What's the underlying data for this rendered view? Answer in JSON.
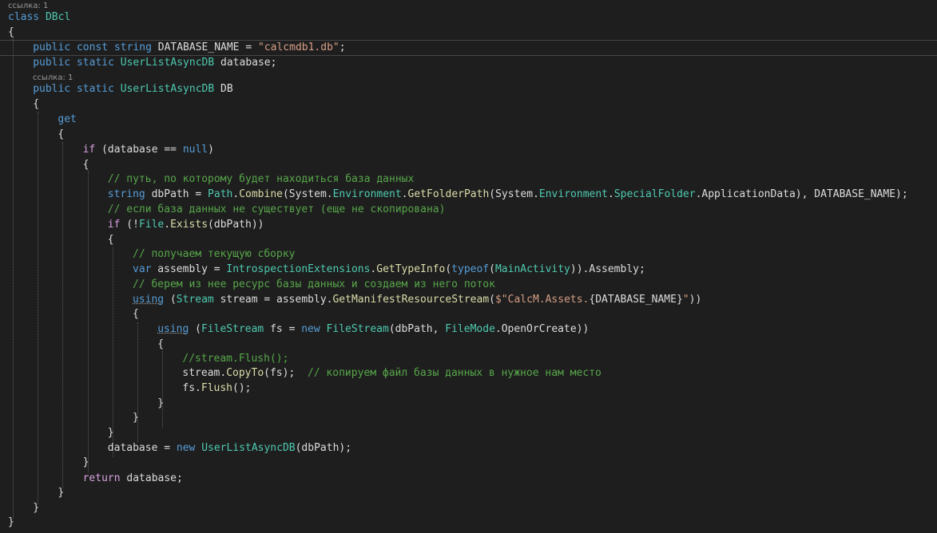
{
  "editor": {
    "code_lens": [
      {
        "text": "ссылка: 1"
      },
      {
        "text": "ссылка: 1"
      }
    ],
    "lines": [
      {
        "tokens": [
          {
            "t": "class",
            "k": "kw"
          },
          {
            "t": " "
          },
          {
            "t": "DBcl",
            "k": "type"
          }
        ]
      },
      {
        "tokens": [
          {
            "t": "{"
          }
        ]
      },
      {
        "tokens": [
          {
            "t": "public",
            "k": "kw"
          },
          {
            "t": " "
          },
          {
            "t": "const",
            "k": "kw"
          },
          {
            "t": " "
          },
          {
            "t": "string",
            "k": "kw"
          },
          {
            "t": " DATABASE_NAME = "
          },
          {
            "t": "\"calcmdb1.db\"",
            "k": "str"
          },
          {
            "t": ";"
          }
        ]
      },
      {
        "tokens": [
          {
            "t": "public",
            "k": "kw"
          },
          {
            "t": " "
          },
          {
            "t": "static",
            "k": "kw"
          },
          {
            "t": " "
          },
          {
            "t": "UserListAsyncDB",
            "k": "type"
          },
          {
            "t": " database;"
          }
        ]
      },
      {
        "tokens": [
          {
            "t": "public",
            "k": "kw"
          },
          {
            "t": " "
          },
          {
            "t": "static",
            "k": "kw"
          },
          {
            "t": " "
          },
          {
            "t": "UserListAsyncDB",
            "k": "type"
          },
          {
            "t": " DB"
          }
        ]
      },
      {
        "tokens": [
          {
            "t": "{"
          }
        ]
      },
      {
        "tokens": [
          {
            "t": "get",
            "k": "kw"
          }
        ]
      },
      {
        "tokens": [
          {
            "t": "{"
          }
        ]
      },
      {
        "tokens": [
          {
            "t": "if",
            "k": "ctl"
          },
          {
            "t": " (database == "
          },
          {
            "t": "null",
            "k": "kw"
          },
          {
            "t": ")"
          }
        ]
      },
      {
        "tokens": [
          {
            "t": "{"
          }
        ]
      },
      {
        "tokens": [
          {
            "t": "// путь, по которому будет находиться база данных",
            "k": "cm"
          }
        ]
      },
      {
        "tokens": [
          {
            "t": "string",
            "k": "kw"
          },
          {
            "t": " dbPath = "
          },
          {
            "t": "Path",
            "k": "type"
          },
          {
            "t": "."
          },
          {
            "t": "Combine",
            "k": "meth"
          },
          {
            "t": "(System."
          },
          {
            "t": "Environment",
            "k": "type"
          },
          {
            "t": "."
          },
          {
            "t": "GetFolderPath",
            "k": "meth"
          },
          {
            "t": "(System."
          },
          {
            "t": "Environment",
            "k": "type"
          },
          {
            "t": "."
          },
          {
            "t": "SpecialFolder",
            "k": "type"
          },
          {
            "t": ".ApplicationData), DATABASE_NAME);"
          }
        ]
      },
      {
        "tokens": [
          {
            "t": "// если база данных не существует (еще не скопирована)",
            "k": "cm"
          }
        ]
      },
      {
        "tokens": [
          {
            "t": "if",
            "k": "ctl"
          },
          {
            "t": " (!"
          },
          {
            "t": "File",
            "k": "type"
          },
          {
            "t": "."
          },
          {
            "t": "Exists",
            "k": "meth"
          },
          {
            "t": "(dbPath))"
          }
        ]
      },
      {
        "tokens": [
          {
            "t": "{"
          }
        ]
      },
      {
        "tokens": [
          {
            "t": "// получаем текущую сборку",
            "k": "cm"
          }
        ]
      },
      {
        "tokens": [
          {
            "t": "var",
            "k": "kw"
          },
          {
            "t": " assembly = "
          },
          {
            "t": "IntrospectionExtensions",
            "k": "type"
          },
          {
            "t": "."
          },
          {
            "t": "GetTypeInfo",
            "k": "meth"
          },
          {
            "t": "("
          },
          {
            "t": "typeof",
            "k": "kw"
          },
          {
            "t": "("
          },
          {
            "t": "MainActivity",
            "k": "type"
          },
          {
            "t": ")).Assembly;"
          }
        ]
      },
      {
        "tokens": [
          {
            "t": "// берем из нее ресурс базы данных и создаем из него поток",
            "k": "cm"
          }
        ]
      },
      {
        "tokens": [
          {
            "t": "using",
            "k": "kw",
            "sq": true
          },
          {
            "t": " ("
          },
          {
            "t": "Stream",
            "k": "type"
          },
          {
            "t": " stream = assembly."
          },
          {
            "t": "GetManifestResourceStream",
            "k": "meth"
          },
          {
            "t": "("
          },
          {
            "t": "$\"CalcM.Assets.",
            "k": "str"
          },
          {
            "t": "{DATABASE_NAME}"
          },
          {
            "t": "\"",
            "k": "str"
          },
          {
            "t": "))"
          }
        ]
      },
      {
        "tokens": [
          {
            "t": "{"
          }
        ]
      },
      {
        "tokens": [
          {
            "t": "using",
            "k": "kw",
            "sq": true
          },
          {
            "t": " ("
          },
          {
            "t": "FileStream",
            "k": "type"
          },
          {
            "t": " fs = "
          },
          {
            "t": "new",
            "k": "kw"
          },
          {
            "t": " "
          },
          {
            "t": "FileStream",
            "k": "type"
          },
          {
            "t": "(dbPath, "
          },
          {
            "t": "FileMode",
            "k": "type"
          },
          {
            "t": ".OpenOrCreate))"
          }
        ]
      },
      {
        "tokens": [
          {
            "t": "{"
          }
        ]
      },
      {
        "tokens": [
          {
            "t": "//stream.Flush();",
            "k": "cm"
          }
        ]
      },
      {
        "tokens": [
          {
            "t": "stream."
          },
          {
            "t": "CopyTo",
            "k": "meth"
          },
          {
            "t": "(fs);  "
          },
          {
            "t": "// копируем файл базы данных в нужное нам место",
            "k": "cm"
          }
        ]
      },
      {
        "tokens": [
          {
            "t": "fs."
          },
          {
            "t": "Flush",
            "k": "meth"
          },
          {
            "t": "();"
          }
        ]
      },
      {
        "tokens": [
          {
            "t": "}"
          }
        ]
      },
      {
        "tokens": [
          {
            "t": "}"
          }
        ]
      },
      {
        "tokens": [
          {
            "t": "}"
          }
        ]
      },
      {
        "tokens": [
          {
            "t": "database = "
          },
          {
            "t": "new",
            "k": "kw"
          },
          {
            "t": " "
          },
          {
            "t": "UserListAsyncDB",
            "k": "type"
          },
          {
            "t": "(dbPath);"
          }
        ]
      },
      {
        "tokens": [
          {
            "t": "}"
          }
        ]
      },
      {
        "tokens": [
          {
            "t": "return",
            "k": "ctl"
          },
          {
            "t": " database;"
          }
        ]
      },
      {
        "tokens": [
          {
            "t": "}"
          }
        ]
      },
      {
        "tokens": [
          {
            "t": "}"
          }
        ]
      },
      {
        "tokens": [
          {
            "t": "}"
          }
        ]
      }
    ]
  },
  "colors": {
    "background": "#1e1e1e",
    "keyword": "#569cd6",
    "control": "#d8a0df",
    "type": "#4ec9b0",
    "string": "#d69d85",
    "comment": "#57a64a",
    "method": "#dcdcaa",
    "plain": "#dcdcdc",
    "codelens": "#999999"
  }
}
